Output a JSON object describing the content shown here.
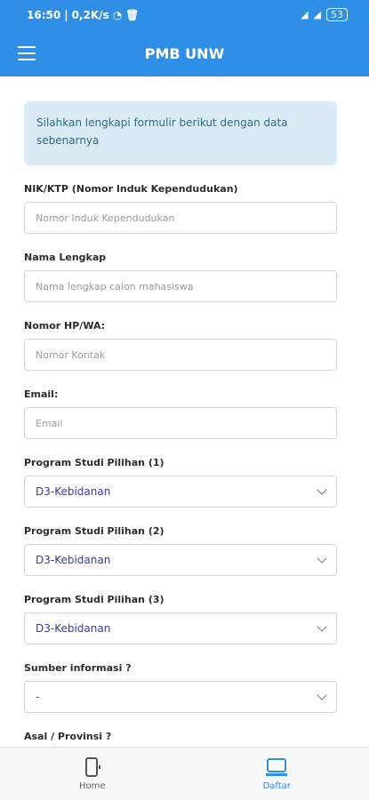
{
  "status": {
    "time": "16:50",
    "speed": "0,2K/s",
    "battery": "53"
  },
  "app": {
    "title": "PMB UNW",
    "hamburger_icon": "hamburger-menu-icon"
  },
  "form": {
    "info": "Silahkan lengkapi formulir berikut dengan data sebenarnya",
    "fields": [
      {
        "label": "NIK/KTP (Nomor Induk Kependudukan)",
        "placeholder": "Nomor Induk Kependudukan"
      },
      {
        "label": "Nama Lengkap",
        "placeholder": "Nama lengkap calon mahasiswa"
      },
      {
        "label": "Nomor HP/WA:",
        "placeholder": "Nomor Kontak"
      },
      {
        "label": "Email:",
        "placeholder": "Email"
      }
    ],
    "selects": [
      {
        "label": "Program Studi Pilihan (1)",
        "value": "D3-Kebidanan"
      },
      {
        "label": "Program Studi Pilihan (2)",
        "value": "D3-Kebidanan"
      },
      {
        "label": "Program Studi Pilihan (3)",
        "value": "D3-Kebidanan"
      },
      {
        "label": "Sumber informasi ?",
        "value": "-"
      },
      {
        "label": "Asal / Provinsi ?",
        "value": ""
      }
    ]
  },
  "nav": {
    "home": "Home",
    "daftar": "Daftar"
  },
  "colors": {
    "primary": "#2f8fe6",
    "info_bg": "#d9ecf5",
    "info_text": "#2c6b86"
  }
}
